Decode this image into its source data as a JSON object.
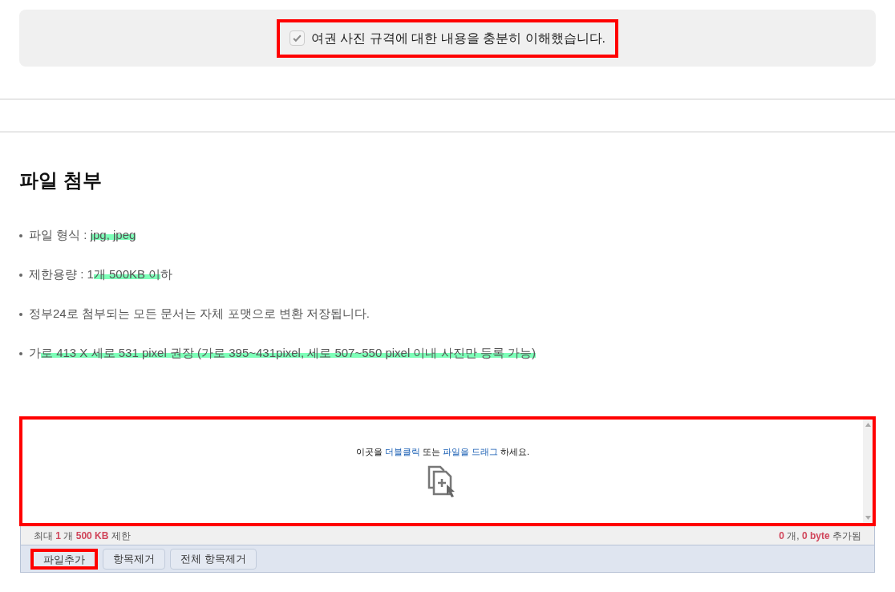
{
  "agreement": {
    "label": "여권 사진 규격에 대한 내용을 충분히 이해했습니다.",
    "checked": true,
    "disabled": true,
    "highlighted": true
  },
  "section": {
    "title": "파일 첨부"
  },
  "bullets": [
    [
      {
        "text": "파일 형식 : ",
        "marked": false
      },
      {
        "text": "jpg, jpeg",
        "marked": true
      }
    ],
    [
      {
        "text": "제한용량 : 1",
        "marked": false
      },
      {
        "text": "개 500KB 이",
        "marked": true
      },
      {
        "text": "하",
        "marked": false
      }
    ],
    [
      {
        "text": "정부24로 첨부되는 모든 문서는 자체 포맷으로 변환 저장됩니다.",
        "marked": false
      }
    ],
    [
      {
        "text": "가",
        "marked": false
      },
      {
        "text": "로 413 X 세로 531 pixel 권장 (가로 395~431pixel, 세로 507~550 pixel 이내 사진만 등록 가능)",
        "marked": true
      }
    ]
  ],
  "dropzone": {
    "highlighted": true,
    "hint": [
      {
        "text": "이곳을 ",
        "kind": "plain"
      },
      {
        "text": "더블클릭",
        "kind": "link"
      },
      {
        "text": " 또는 ",
        "kind": "plain"
      },
      {
        "text": "파일을 드래그",
        "kind": "link"
      },
      {
        "text": " 하세요.",
        "kind": "plain"
      }
    ]
  },
  "limit_info": [
    {
      "text": "최대 ",
      "kind": "plain"
    },
    {
      "text": "1",
      "kind": "number"
    },
    {
      "text": " 개 ",
      "kind": "plain"
    },
    {
      "text": "500 KB",
      "kind": "number"
    },
    {
      "text": " 제한",
      "kind": "plain"
    }
  ],
  "added_info": [
    {
      "text": "0",
      "kind": "number"
    },
    {
      "text": " 개, ",
      "kind": "plain"
    },
    {
      "text": "0 byte",
      "kind": "number"
    },
    {
      "text": " 추가됨",
      "kind": "plain"
    }
  ],
  "buttons": [
    {
      "label": "파일추가",
      "highlighted": true
    },
    {
      "label": "항목제거",
      "highlighted": false
    },
    {
      "label": "전체 항목제거",
      "highlighted": false
    }
  ]
}
